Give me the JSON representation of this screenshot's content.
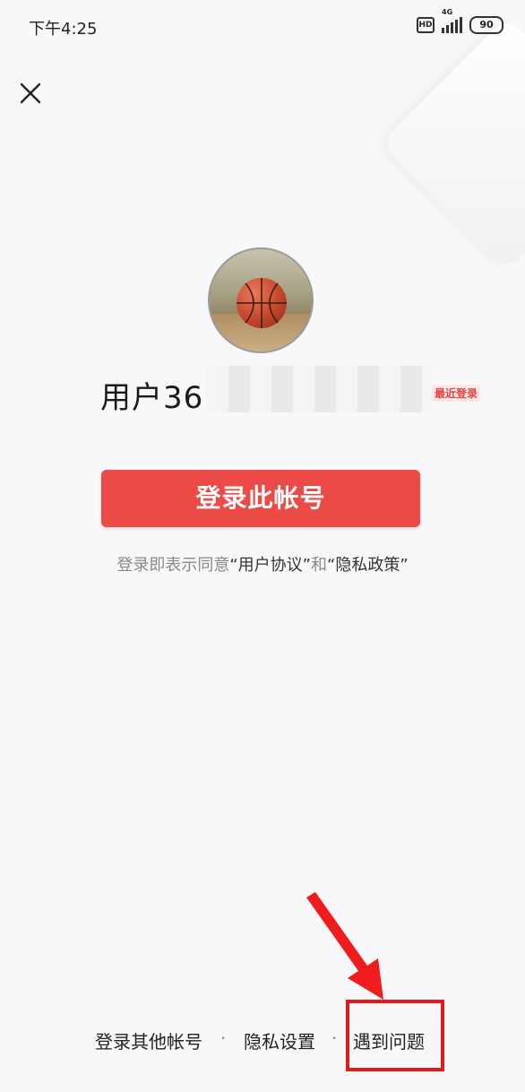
{
  "status_bar": {
    "time": "下午4:25",
    "network": "4G",
    "battery": "90",
    "hd_label": "HD"
  },
  "close": {
    "icon": "close-icon"
  },
  "account": {
    "avatar": "basketball-avatar",
    "username": "用户36",
    "recent_badge": "最近登录"
  },
  "login_button": {
    "label": "登录此帐号"
  },
  "agreement": {
    "prefix": "登录即表示同意",
    "user_agreement": "“用户协议”",
    "and": "和",
    "privacy_policy": "“隐私政策”"
  },
  "bottom_links": {
    "other_account": "登录其他帐号",
    "privacy_settings": "隐私设置",
    "help": "遇到问题",
    "separator": "·"
  },
  "annotation": {
    "color": "#e11a1a"
  },
  "colors": {
    "primary_button": "#ec4a46",
    "background": "#f8f8fa"
  }
}
